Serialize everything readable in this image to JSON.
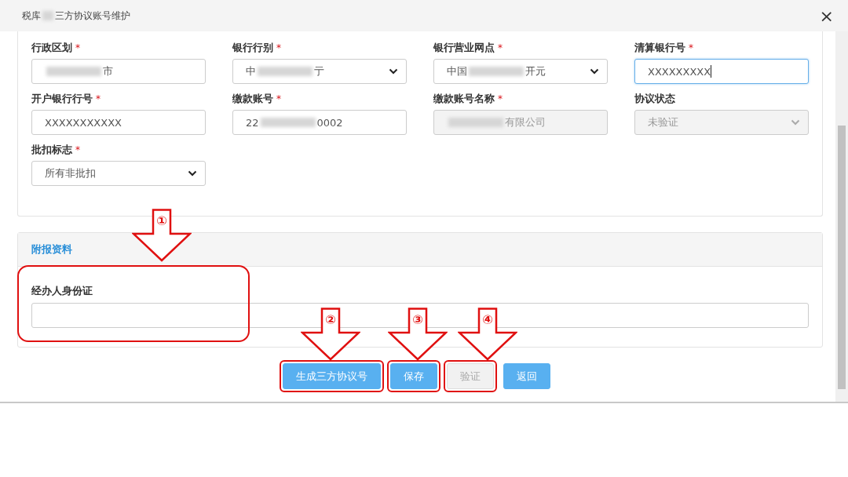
{
  "window": {
    "title_prefix": "税库",
    "title_suffix": "三方协议账号维护",
    "close": "×"
  },
  "fields": [
    {
      "label": "行政区划",
      "required_mark": "*",
      "kind": "input",
      "value_suffix": "市",
      "redacted": true,
      "disabled": false,
      "focused": false
    },
    {
      "label": "银行行别",
      "required_mark": "*",
      "kind": "select",
      "value_prefix": "中",
      "value_suffix": "亍",
      "redacted": true,
      "disabled": false,
      "focused": false
    },
    {
      "label": "银行营业网点",
      "required_mark": "*",
      "kind": "select",
      "value_prefix": "中国",
      "value_suffix": "开元",
      "redacted": true,
      "disabled": false,
      "focused": false
    },
    {
      "label": "清算银行号",
      "required_mark": "*",
      "kind": "input",
      "value_prefix": "XXXXXXXXX",
      "disabled": false,
      "focused": true
    },
    {
      "label": "开户银行行号",
      "required_mark": "*",
      "kind": "input",
      "value_prefix": "XXXXXXXXXXX",
      "disabled": false,
      "focused": false
    },
    {
      "label": "缴款账号",
      "required_mark": "*",
      "kind": "input",
      "value_prefix": "22",
      "value_suffix": "0002",
      "redacted": true,
      "disabled": false,
      "focused": false
    },
    {
      "label": "缴款账号名称",
      "required_mark": "*",
      "kind": "input",
      "value_suffix": "有限公司",
      "redacted": true,
      "disabled": true,
      "focused": false
    },
    {
      "label": "协议状态",
      "kind": "select",
      "value_prefix": "未验证",
      "disabled": true,
      "focused": false
    },
    {
      "label": "批扣标志",
      "required_mark": "*",
      "kind": "select",
      "value_prefix": "所有非批扣",
      "disabled": false,
      "focused": false
    }
  ],
  "attachments": {
    "title": "附报资料",
    "field_label": "经办人身份证",
    "highlighted": true
  },
  "buttons": [
    {
      "label": "生成三方协议号",
      "disabled": false,
      "highlighted": true
    },
    {
      "label": "保存",
      "disabled": false,
      "highlighted": true
    },
    {
      "label": "验证",
      "disabled": true,
      "highlighted": true
    },
    {
      "label": "返回",
      "disabled": false,
      "highlighted": false
    }
  ],
  "annotations": [
    {
      "number": "①"
    },
    {
      "number": "②"
    },
    {
      "number": "③"
    },
    {
      "number": "④"
    }
  ]
}
